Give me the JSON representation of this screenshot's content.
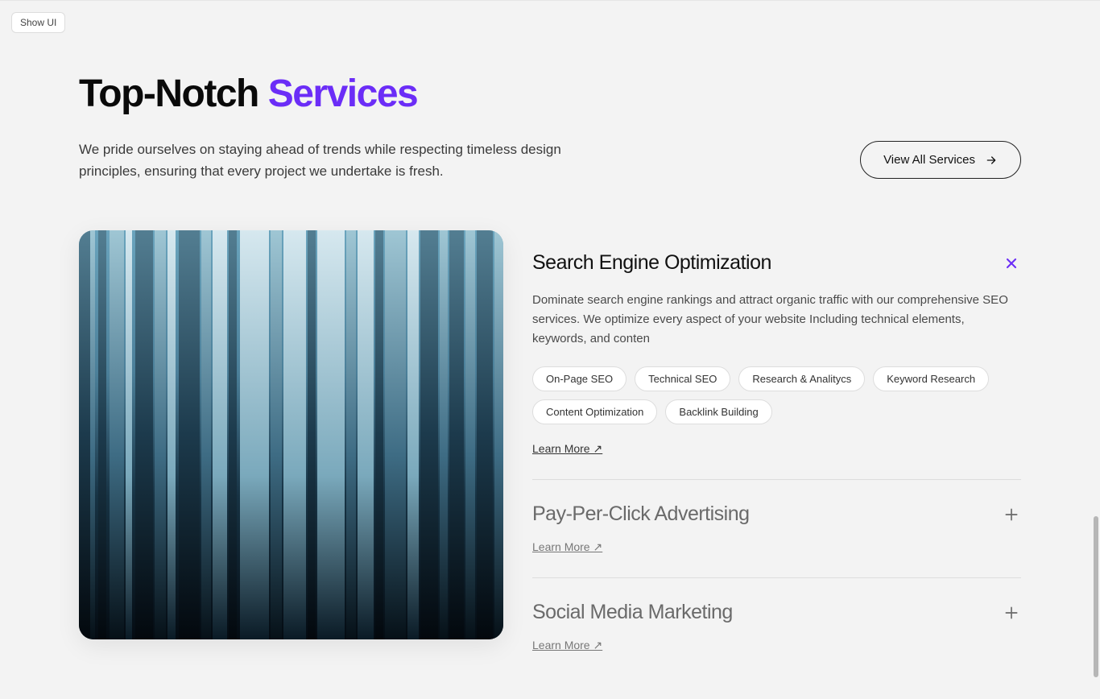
{
  "showui": "Show UI",
  "title_part1": "Top-Notch ",
  "title_part2": "Services",
  "subtitle": "We pride ourselves on staying ahead of trends while respecting timeless design principles, ensuring that every project we undertake is fresh.",
  "view_all": "View All Services",
  "services": [
    {
      "title": "Search Engine Optimization",
      "expanded": true,
      "description": "Dominate search engine rankings and attract organic traffic with our comprehensive SEO services. We optimize every aspect of your website Including technical elements, keywords, and conten",
      "tags": [
        "On-Page SEO",
        "Technical SEO",
        "Research & Analitycs",
        "Keyword Research",
        "Content Optimization",
        "Backlink Building"
      ],
      "learn": "Learn More ↗"
    },
    {
      "title": "Pay-Per-Click Advertising",
      "expanded": false,
      "learn": "Learn More ↗"
    },
    {
      "title": "Social Media Marketing",
      "expanded": false,
      "learn": "Learn More ↗"
    }
  ]
}
